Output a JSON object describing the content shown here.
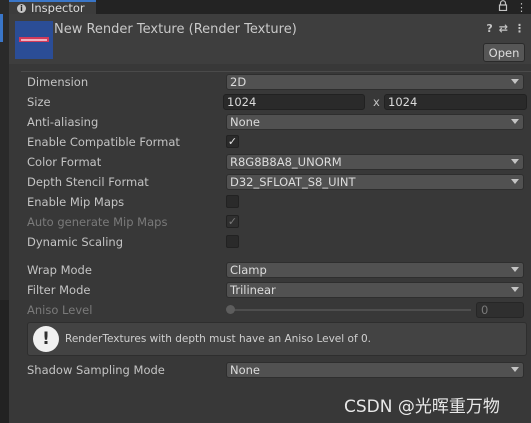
{
  "tab": {
    "label": "Inspector"
  },
  "tab_icons": [
    "lock-icon",
    "menu-icon"
  ],
  "header": {
    "title": "New Render Texture (Render Texture)",
    "help_icon": "?",
    "settings_icon": "⇄",
    "more_icon": "⋮",
    "open_label": "Open"
  },
  "fields": {
    "dimension": {
      "label": "Dimension",
      "value": "2D"
    },
    "size": {
      "label": "Size",
      "width": "1024",
      "x": "x",
      "height": "1024"
    },
    "anti_aliasing": {
      "label": "Anti-aliasing",
      "value": "None"
    },
    "enable_compatible_format": {
      "label": "Enable Compatible Format",
      "checked": true,
      "mark": "✓"
    },
    "color_format": {
      "label": "Color Format",
      "value": "R8G8B8A8_UNORM"
    },
    "depth_stencil_format": {
      "label": "Depth Stencil Format",
      "value": "D32_SFLOAT_S8_UINT"
    },
    "enable_mip_maps": {
      "label": "Enable Mip Maps",
      "checked": false,
      "mark": ""
    },
    "auto_generate_mip_maps": {
      "label": "Auto generate Mip Maps",
      "checked": true,
      "disabled": true,
      "mark": "✓"
    },
    "dynamic_scaling": {
      "label": "Dynamic Scaling",
      "checked": false,
      "mark": ""
    },
    "wrap_mode": {
      "label": "Wrap Mode",
      "value": "Clamp"
    },
    "filter_mode": {
      "label": "Filter Mode",
      "value": "Trilinear"
    },
    "aniso_level": {
      "label": "Aniso Level",
      "value": "0",
      "disabled": true
    },
    "shadow_sampling_mode": {
      "label": "Shadow Sampling Mode",
      "value": "None"
    }
  },
  "help_box": {
    "icon": "!",
    "message": "RenderTextures with depth must have an Aniso Level of 0."
  },
  "watermark": "CSDN @光晖重万物"
}
